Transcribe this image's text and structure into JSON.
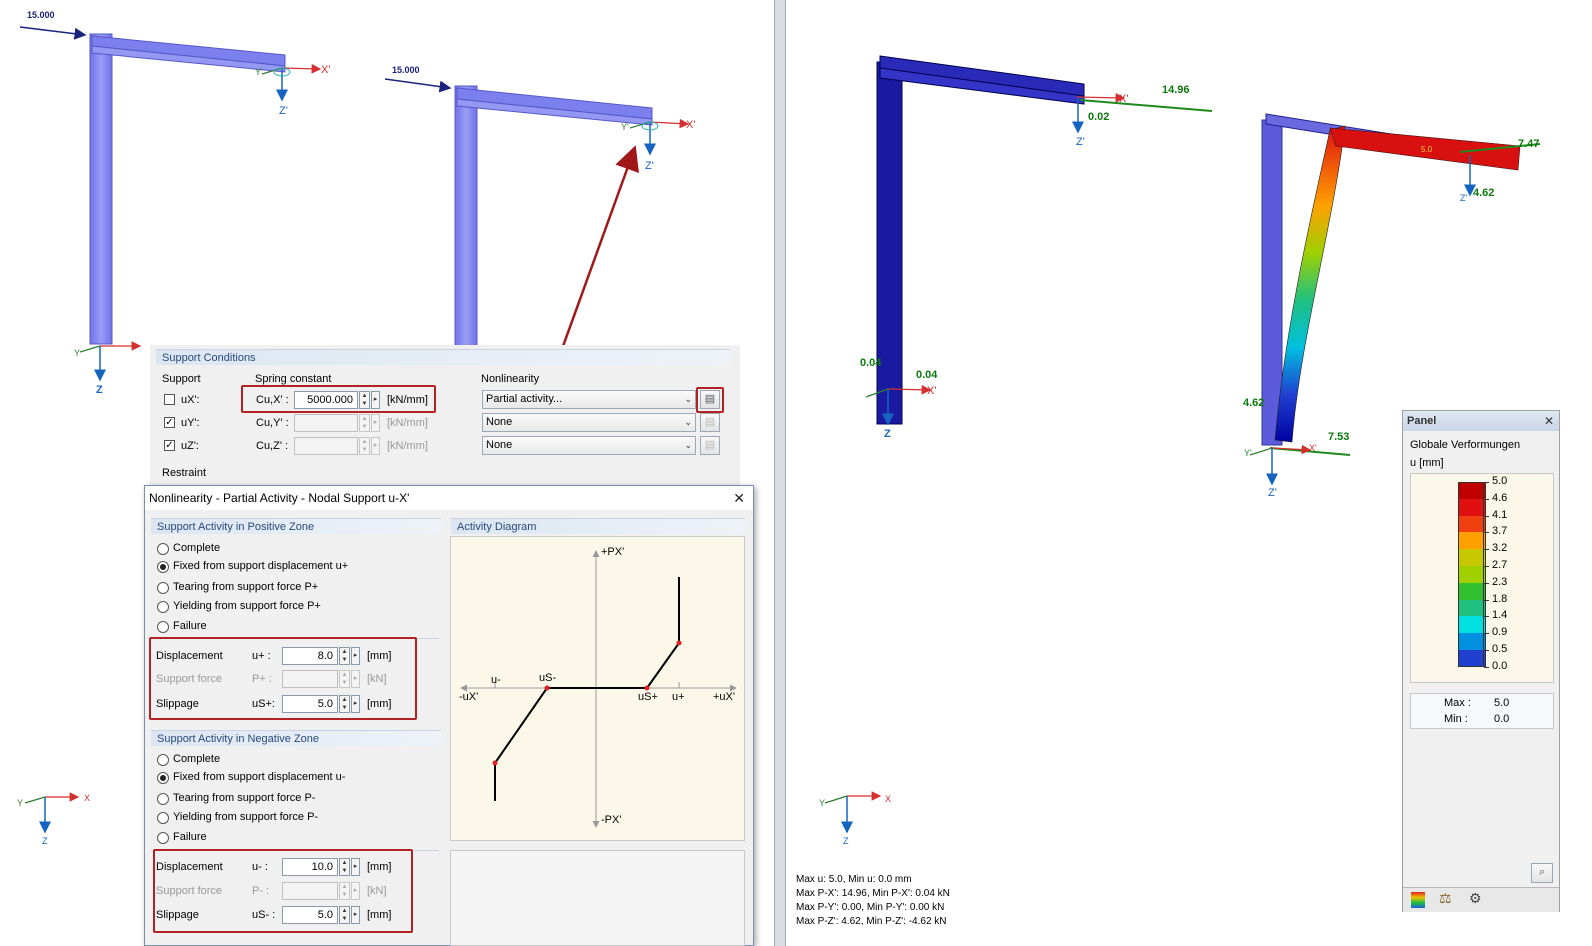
{
  "viewport_left": {
    "load1": "15.000",
    "load2": "15.000",
    "axes": {
      "x": "X'",
      "y": "Y'",
      "z": "Z'"
    },
    "global_axes": {
      "x": "X",
      "y": "Y",
      "z": "Z"
    }
  },
  "support_conditions": {
    "header": "Support Conditions",
    "col_support": "Support",
    "col_spring": "Spring constant",
    "col_nonlin": "Nonlinearity",
    "rows": [
      {
        "checked": false,
        "label": "uX':",
        "const": "Cu,X' :",
        "value": "5000.000",
        "unit": "[kN/mm]",
        "nonlinearity": "Partial activity...",
        "enabled": true
      },
      {
        "checked": true,
        "label": "uY':",
        "const": "Cu,Y' :",
        "value": "",
        "unit": "[kN/mm]",
        "nonlinearity": "None",
        "enabled": false
      },
      {
        "checked": true,
        "label": "uZ':",
        "const": "Cu,Z' :",
        "value": "",
        "unit": "[kN/mm]",
        "nonlinearity": "None",
        "enabled": false
      }
    ],
    "restraint": "Restraint"
  },
  "nonlinearity_dialog": {
    "title": "Nonlinearity - Partial Activity - Nodal Support u-X'",
    "close": "✕",
    "positive": {
      "header": "Support Activity in Positive Zone",
      "options": [
        "Complete",
        "Fixed from support displacement u+",
        "Tearing from support force P+",
        "Yielding from support force P+",
        "Failure"
      ],
      "selected_index": 1,
      "fields": [
        {
          "label": "Displacement",
          "sym": "u+ :",
          "value": "8.0",
          "unit": "[mm]",
          "enabled": true
        },
        {
          "label": "Support force",
          "sym": "P+ :",
          "value": "",
          "unit": "[kN]",
          "enabled": false
        },
        {
          "label": "Slippage",
          "sym": "uS+:",
          "value": "5.0",
          "unit": "[mm]",
          "enabled": true
        }
      ]
    },
    "negative": {
      "header": "Support Activity in Negative Zone",
      "options": [
        "Complete",
        "Fixed from support displacement u-",
        "Tearing from support force P-",
        "Yielding from support force P-",
        "Failure"
      ],
      "selected_index": 1,
      "fields": [
        {
          "label": "Displacement",
          "sym": "u- :",
          "value": "10.0",
          "unit": "[mm]",
          "enabled": true
        },
        {
          "label": "Support force",
          "sym": "P- :",
          "value": "",
          "unit": "[kN]",
          "enabled": false
        },
        {
          "label": "Slippage",
          "sym": "uS- :",
          "value": "5.0",
          "unit": "[mm]",
          "enabled": true
        }
      ]
    },
    "activity_diagram": {
      "header": "Activity Diagram",
      "labels": {
        "p_pos": "+PX'",
        "p_neg": "-PX'",
        "u_pos": "+uX'",
        "u_neg": "-uX'",
        "u_minus": "u-",
        "us_minus": "uS-",
        "us_plus": "uS+",
        "u_plus": "u+"
      }
    }
  },
  "viewport_right": {
    "values": {
      "v1": "14.96",
      "v2": "0.02",
      "v3": "0.04",
      "v4": "0.04",
      "v5": "7.47",
      "v6": "4.62",
      "v7": "4.62",
      "v8": "7.53",
      "v9": "5.0"
    },
    "axes": {
      "x": "X'",
      "y": "Y'",
      "z": "Z'"
    },
    "global_axes": {
      "x": "X",
      "y": "Y",
      "z": "Z"
    },
    "results": [
      "Max u: 5.0, Min u: 0.0 mm",
      "Max P-X': 14.96, Min P-X': 0.04 kN",
      "Max P-Y': 0.00, Min P-Y': 0.00 kN",
      "Max P-Z': 4.62, Min P-Z': -4.62 kN"
    ]
  },
  "legend_panel": {
    "title": "Panel",
    "close": "✕",
    "subtitle": "Globale Verformungen",
    "unit": "u [mm]",
    "scale": [
      {
        "value": "5.0",
        "color": "#c00000"
      },
      {
        "value": "4.6",
        "color": "#e01010"
      },
      {
        "value": "4.1",
        "color": "#f04010"
      },
      {
        "value": "3.7",
        "color": "#ffa000"
      },
      {
        "value": "3.2",
        "color": "#c8c800"
      },
      {
        "value": "2.7",
        "color": "#a0d000"
      },
      {
        "value": "2.3",
        "color": "#30c030"
      },
      {
        "value": "1.8",
        "color": "#20c080"
      },
      {
        "value": "1.4",
        "color": "#00e0e0"
      },
      {
        "value": "0.9",
        "color": "#0090e0"
      },
      {
        "value": "0.5",
        "color": "#2040d0"
      },
      {
        "value": "0.0",
        "color": "#0000a0"
      }
    ],
    "max_label": "Max :",
    "max_value": "5.0",
    "min_label": "Min :",
    "min_value": "0.0"
  }
}
